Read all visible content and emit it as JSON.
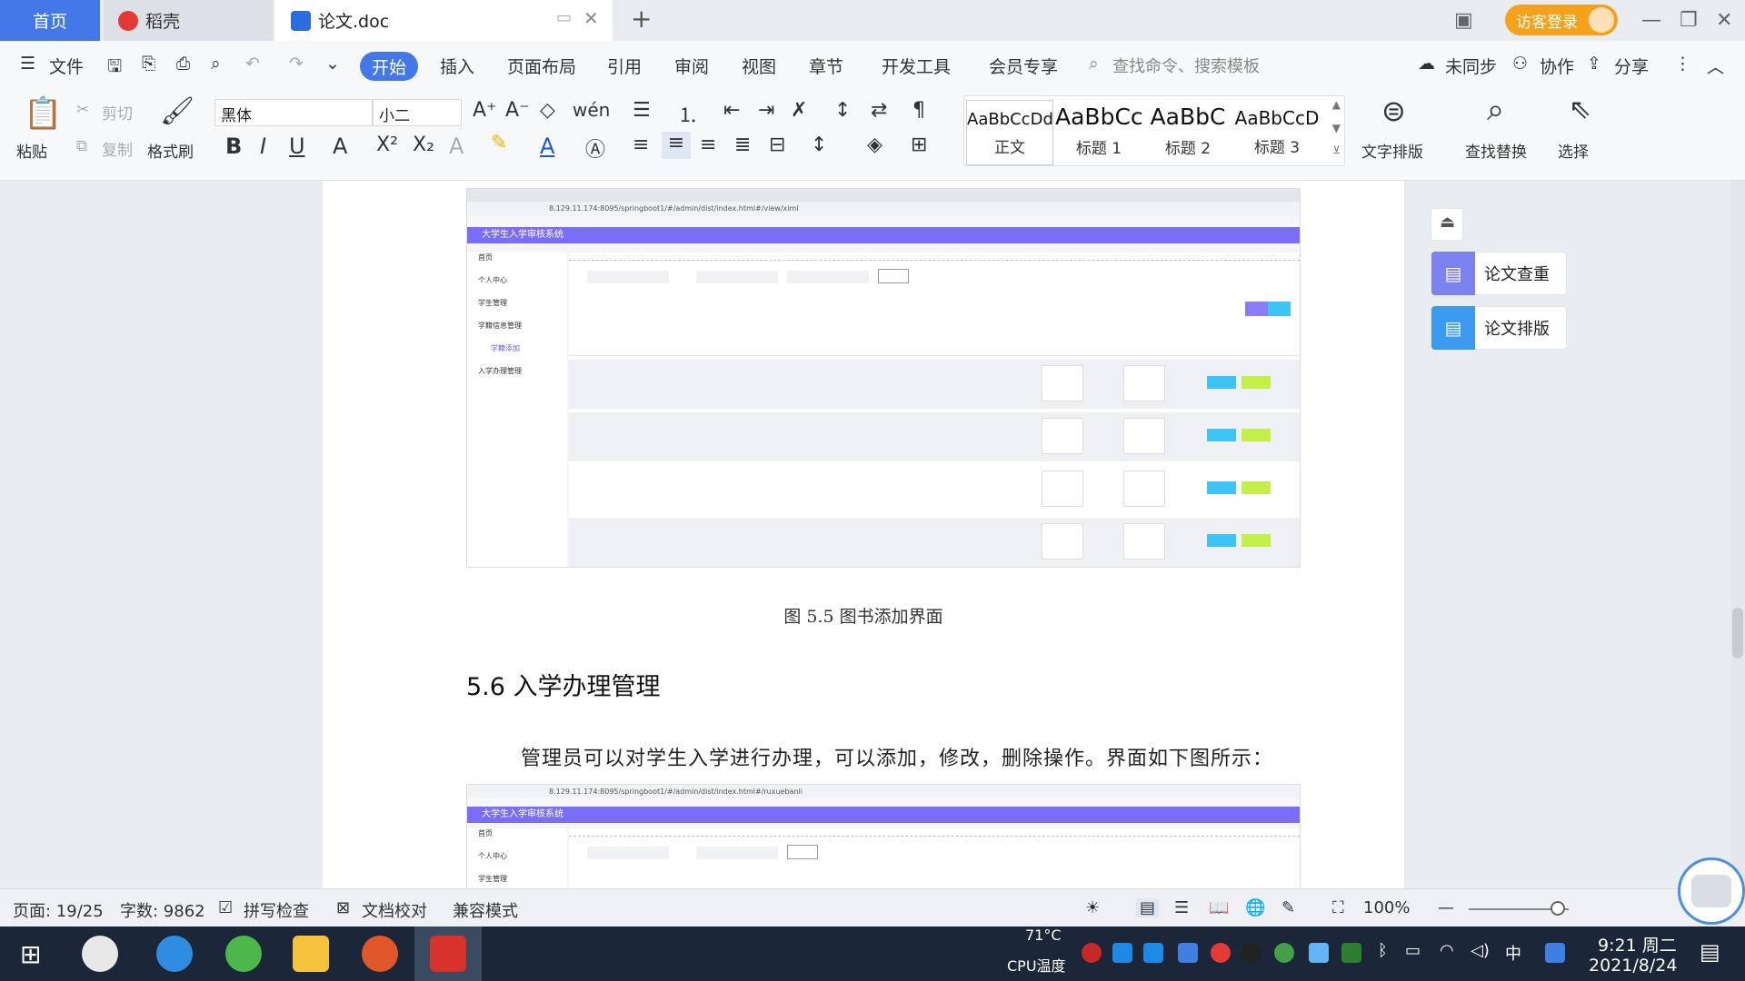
{
  "titlebar": {
    "tabs": [
      {
        "label": "首页"
      },
      {
        "label": "稻壳"
      },
      {
        "label": "论文.doc"
      }
    ],
    "visitor_login": "访客登录"
  },
  "menu": {
    "file": "文件",
    "items": [
      "开始",
      "插入",
      "页面布局",
      "引用",
      "审阅",
      "视图",
      "章节",
      "开发工具",
      "会员专享"
    ],
    "search_placeholder": "查找命令、搜索模板",
    "right": {
      "sync": "未同步",
      "collab": "协作",
      "share": "分享"
    }
  },
  "ribbon": {
    "paste": "粘贴",
    "cut": "剪切",
    "copy": "复制",
    "format_painter": "格式刷",
    "font_name": "黑体",
    "font_size": "小二",
    "styles": [
      {
        "preview": "AaBbCcDd",
        "name": "正文"
      },
      {
        "preview": "AaBbCc",
        "name": "标题 1"
      },
      {
        "preview": "AaBbC",
        "name": "标题 2"
      },
      {
        "preview": "AaBbCcD",
        "name": "标题 3"
      }
    ],
    "text_layout": "文字排版",
    "find_replace": "查找替换",
    "select": "选择"
  },
  "document": {
    "figure1": {
      "app_title": "大学生入学审核系统",
      "url": "8.129.11.174:8095/springboot1/#/admin/dist/index.html#/view/ximl",
      "sidebar": [
        "首页",
        "个人中心",
        "学生管理",
        "学籍信息管理",
        "学籍添加",
        "入学办理管理"
      ],
      "rows": 4
    },
    "caption": "图 5.5  图书添加界面",
    "section_heading": "5.6  入学办理管理",
    "paragraph": "管理员可以对学生入学进行办理，可以添加，修改，删除操作。界面如下图所示：",
    "figure2": {
      "app_title": "大学生入学审核系统",
      "url": "8.129.11.174:8095/springboot1/#/admin/dist/index.html#/ruxuebanli",
      "sidebar": [
        "首页",
        "个人中心",
        "学生管理"
      ]
    }
  },
  "side_panel": {
    "paper_check": "论文查重",
    "paper_layout": "论文排版"
  },
  "statusbar": {
    "page": "页面: 19/25",
    "word_count": "字数: 9862",
    "spell_check": "拼写检查",
    "proofread": "文档校对",
    "compat_mode": "兼容模式",
    "zoom": "100%",
    "zoom_level": 1.0
  },
  "taskbar": {
    "temp": "71°C",
    "cpu": "CPU温度",
    "ime": "中",
    "time": "9:21 周二",
    "date": "2021/8/24"
  },
  "colors": {
    "accent": "#4478e8",
    "visitor": "#f4a21b",
    "app_header": "#7b6ef6",
    "taskbar": "#1b2738"
  }
}
